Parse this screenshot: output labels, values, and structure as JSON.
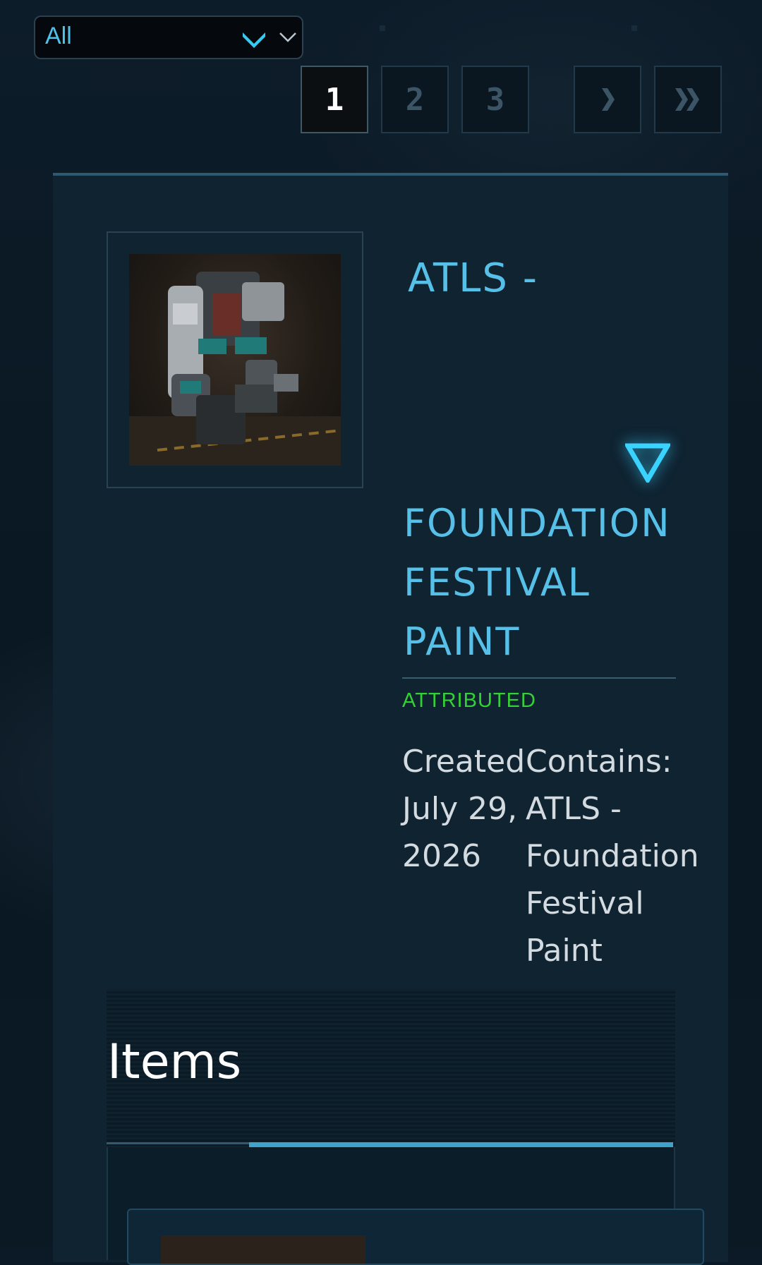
{
  "filter": {
    "selected": "All"
  },
  "pagination": {
    "pages": [
      "1",
      "2",
      "3"
    ],
    "current": "1",
    "next_icon": "chevron-right-icon",
    "last_icon": "double-chevron-right-icon"
  },
  "item": {
    "title_top": "ATLS -",
    "title_main": "FOUNDATION FESTIVAL PAINT",
    "status": "ATTRIBUTED",
    "status_color": "#35d035",
    "created_text": "Created July 29, 2026",
    "contains_text": "Contains: ATLS - Foundation Festival Paint"
  },
  "items_section": {
    "title": "Items"
  },
  "colors": {
    "accent": "#56c0e8",
    "background": "#0b1a26",
    "card": "#0f2331"
  }
}
